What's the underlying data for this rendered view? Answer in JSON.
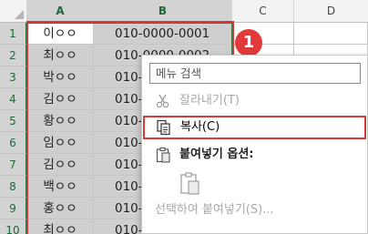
{
  "columns": [
    "A",
    "B",
    "C",
    "D"
  ],
  "rows": [
    {
      "num": "1",
      "name": "이ㅇㅇ",
      "phone": "010-0000-0001"
    },
    {
      "num": "2",
      "name": "최ㅇㅇ",
      "phone": "010-0000-0002"
    },
    {
      "num": "3",
      "name": "박ㅇㅇ",
      "phone": "010-"
    },
    {
      "num": "4",
      "name": "김ㅇㅇ",
      "phone": "010-"
    },
    {
      "num": "5",
      "name": "황ㅇㅇ",
      "phone": "010-"
    },
    {
      "num": "6",
      "name": "임ㅇㅇ",
      "phone": "010-"
    },
    {
      "num": "7",
      "name": "김ㅇㅇ",
      "phone": "010-"
    },
    {
      "num": "8",
      "name": "백ㅇㅇ",
      "phone": "010-"
    },
    {
      "num": "9",
      "name": "홍ㅇㅇ",
      "phone": "010-"
    },
    {
      "num": "10",
      "name": "최ㅇㅇ",
      "phone": "010-"
    }
  ],
  "step_badge": "1",
  "context_menu": {
    "search_placeholder": "메뉴 검색",
    "cut": "잘라내기(T)",
    "copy": "복사(C)",
    "paste_options_header": "붙여넣기 옵션:",
    "paste_special": "선택하여 붙여넣기(S)..."
  },
  "colors": {
    "selection_fill": "#cfcfcf",
    "selection_border": "#2e7d46",
    "highlight_red": "#d43a3a"
  }
}
